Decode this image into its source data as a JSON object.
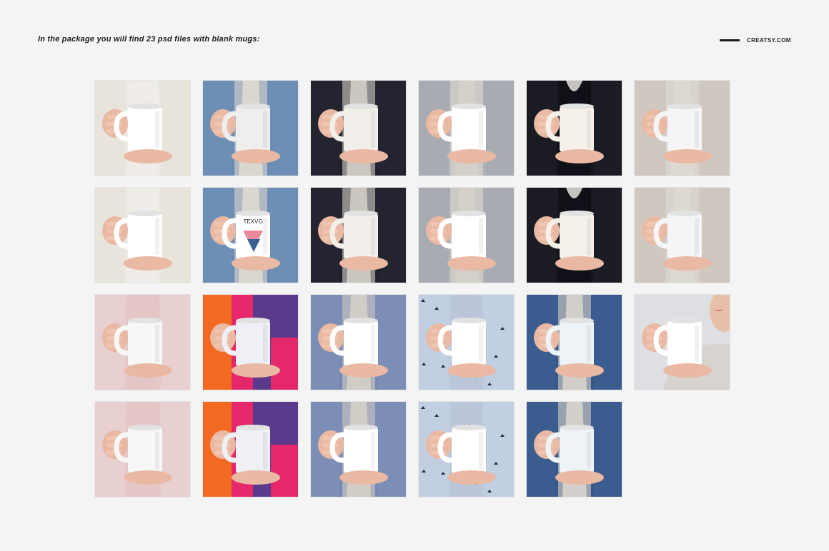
{
  "header": {
    "title": "In the package you will find 23 psd files with blank mugs:",
    "brand": "CREATSY.COM"
  },
  "tiles": [
    {
      "style": "cream-knit",
      "bg": "#eceae5",
      "garment": "#e8e4dc",
      "inner": "#f0ede8",
      "mug": "#ffffff"
    },
    {
      "style": "denim-shirt",
      "bg": "#5f82ab",
      "garment": "#6d8fb6",
      "inner": "#dad6d0",
      "mug": "#eeeeee"
    },
    {
      "style": "black-leather",
      "bg": "#1e1e28",
      "garment": "#242430",
      "inner": "#cbc6c0",
      "mug": "#f2efea"
    },
    {
      "style": "gray-coat",
      "bg": "#b9bcc0",
      "garment": "#a8acb2",
      "inner": "#d4cfc8",
      "mug": "#ffffff"
    },
    {
      "style": "black-fur",
      "bg": "#101018",
      "garment": "#1b1b24",
      "inner": "#101018",
      "mug": "#f5f1e9"
    },
    {
      "style": "gray-knit",
      "bg": "#d2ccc6",
      "garment": "#cfc8c1",
      "inner": "#ddd8d2",
      "mug": "#f5f5f7"
    },
    {
      "style": "cream-knit",
      "bg": "#eceae5",
      "garment": "#e8e4dc",
      "inner": "#f0ede8",
      "mug": "#ffffff"
    },
    {
      "style": "denim-shirt-print",
      "bg": "#5f82ab",
      "garment": "#6d8fb6",
      "inner": "#dad6d0",
      "mug": "#ffffff",
      "print": "TEXVO"
    },
    {
      "style": "black-leather",
      "bg": "#1e1e28",
      "garment": "#242430",
      "inner": "#cbc6c0",
      "mug": "#f2efea"
    },
    {
      "style": "gray-coat",
      "bg": "#b9bcc0",
      "garment": "#a8acb2",
      "inner": "#d4cfc8",
      "mug": "#ffffff"
    },
    {
      "style": "black-fur",
      "bg": "#101018",
      "garment": "#1b1b24",
      "inner": "#101018",
      "mug": "#f5f1e9"
    },
    {
      "style": "gray-knit",
      "bg": "#d2ccc6",
      "garment": "#cfc8c1",
      "inner": "#ddd8d2",
      "mug": "#f5f5f7"
    },
    {
      "style": "pink-sweater",
      "bg": "#e4c6c6",
      "garment": "#e8cfd0",
      "inner": "#e4c6c6",
      "mug": "#f7f7f7"
    },
    {
      "style": "color-knit",
      "bg": "#e5286b",
      "garment": "#f26a21",
      "inner": "#5b3a8c",
      "mug": "#eef0f5"
    },
    {
      "style": "blue-shirt",
      "bg": "#6c7fa8",
      "garment": "#7c8eb5",
      "inner": "#d0ccc6",
      "mug": "#ffffff"
    },
    {
      "style": "light-blue-print",
      "bg": "#b9c7dc",
      "garment": "#c2cfe2",
      "inner": "#bac6d8",
      "mug": "#ffffff"
    },
    {
      "style": "dark-denim",
      "bg": "#2e4d7c",
      "garment": "#3b5c8e",
      "inner": "#d2cfca",
      "mug": "#eef3f8"
    },
    {
      "style": "woman-drinking",
      "bg": "#dedfe3",
      "garment": "#d7d3cf",
      "inner": "#dedfe3",
      "mug": "#ffffff"
    },
    {
      "style": "pink-sweater",
      "bg": "#e4c6c6",
      "garment": "#e8cfd0",
      "inner": "#e4c6c6",
      "mug": "#f7f7f7"
    },
    {
      "style": "color-knit",
      "bg": "#e5286b",
      "garment": "#f26a21",
      "inner": "#5b3a8c",
      "mug": "#eef0f5"
    },
    {
      "style": "blue-shirt",
      "bg": "#6c7fa8",
      "garment": "#7c8eb5",
      "inner": "#d0ccc6",
      "mug": "#ffffff"
    },
    {
      "style": "light-blue-print",
      "bg": "#b9c7dc",
      "garment": "#c2cfe2",
      "inner": "#bac6d8",
      "mug": "#ffffff"
    },
    {
      "style": "dark-denim",
      "bg": "#2e4d7c",
      "garment": "#3b5c8e",
      "inner": "#d2cfca",
      "mug": "#eef3f8"
    }
  ]
}
